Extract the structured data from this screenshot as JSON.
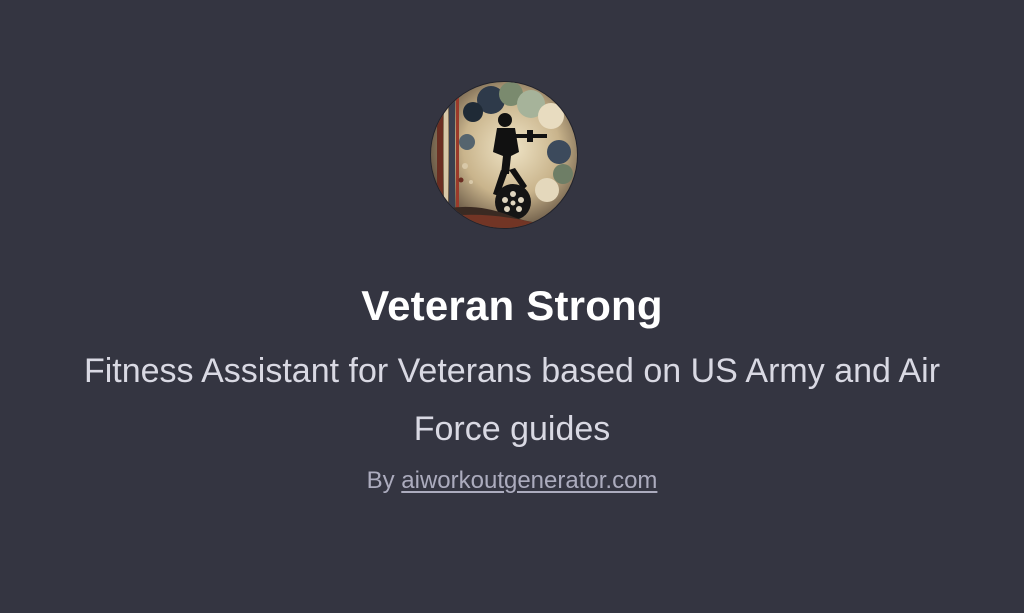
{
  "gpt": {
    "avatar_icon": "veteran-soldier-avatar-icon",
    "title": "Veteran Strong",
    "description": "Fitness Assistant for Veterans based on US Army and Air Force guides",
    "byline_prefix": "By",
    "author_link": "aiworkoutgenerator.com"
  },
  "colors": {
    "background": "#343541",
    "title": "#ffffff",
    "description": "#d9d9e3",
    "byline": "#acacbe"
  }
}
